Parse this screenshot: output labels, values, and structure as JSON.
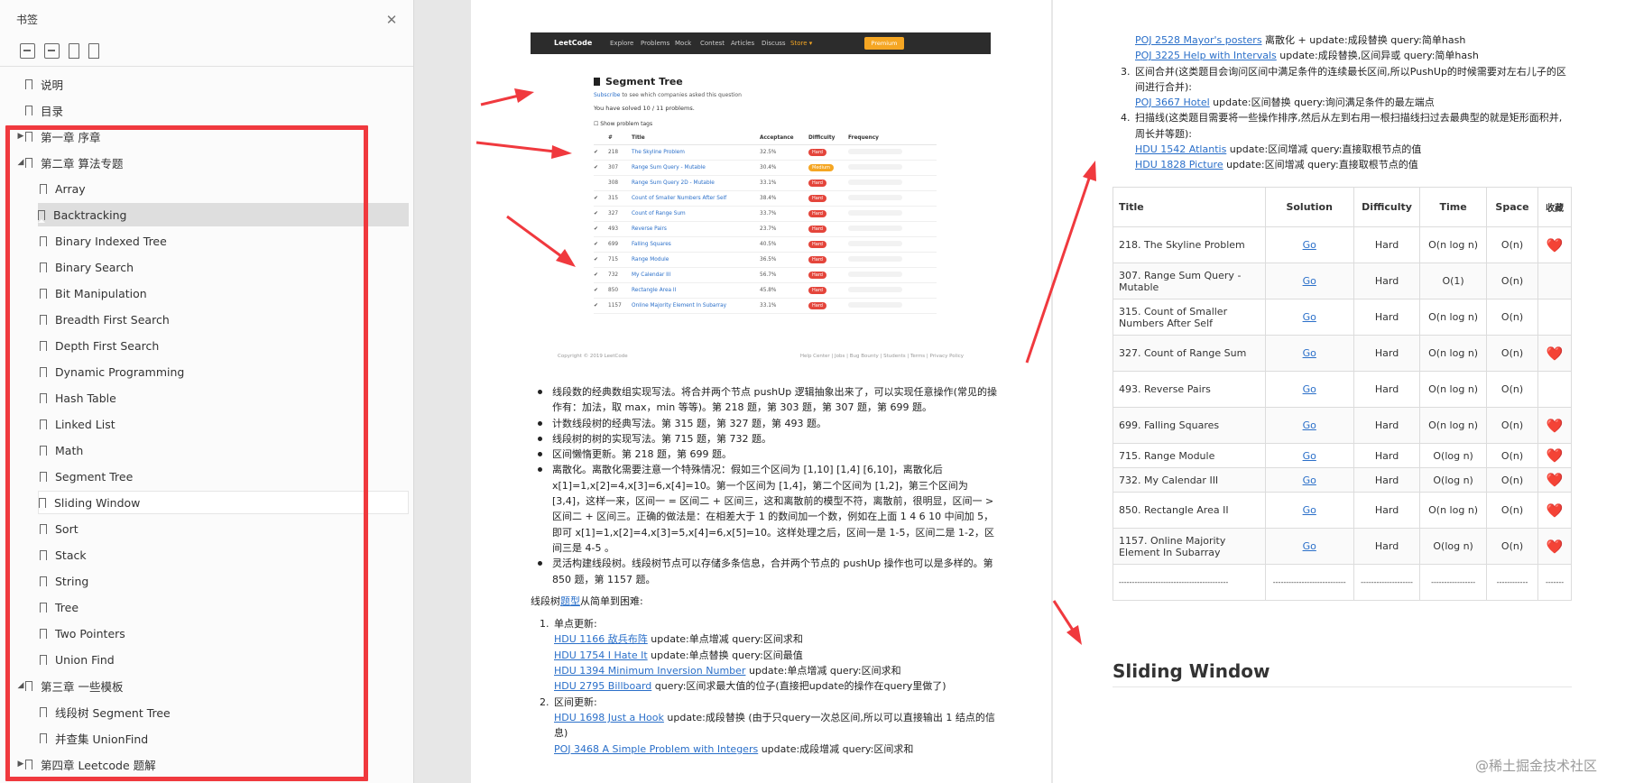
{
  "sidebar": {
    "title": "书签",
    "toc": [
      {
        "label": "说明",
        "level": 0,
        "arrow": ""
      },
      {
        "label": "目录",
        "level": 0,
        "arrow": ""
      },
      {
        "label": "第一章 序章",
        "level": 0,
        "arrow": "▶"
      },
      {
        "label": "第二章 算法专题",
        "level": 0,
        "arrow": "◢"
      },
      {
        "label": "Array",
        "level": 1,
        "arrow": ""
      },
      {
        "label": "Backtracking",
        "level": 1,
        "arrow": "",
        "state": "selected"
      },
      {
        "label": "Binary Indexed Tree",
        "level": 1,
        "arrow": ""
      },
      {
        "label": "Binary Search",
        "level": 1,
        "arrow": ""
      },
      {
        "label": "Bit Manipulation",
        "level": 1,
        "arrow": ""
      },
      {
        "label": "Breadth First Search",
        "level": 1,
        "arrow": ""
      },
      {
        "label": "Depth First Search",
        "level": 1,
        "arrow": ""
      },
      {
        "label": "Dynamic Programming",
        "level": 1,
        "arrow": ""
      },
      {
        "label": "Hash Table",
        "level": 1,
        "arrow": ""
      },
      {
        "label": "Linked List",
        "level": 1,
        "arrow": ""
      },
      {
        "label": "Math",
        "level": 1,
        "arrow": ""
      },
      {
        "label": "Segment Tree",
        "level": 1,
        "arrow": ""
      },
      {
        "label": "Sliding Window",
        "level": 1,
        "arrow": "",
        "state": "hover"
      },
      {
        "label": "Sort",
        "level": 1,
        "arrow": ""
      },
      {
        "label": "Stack",
        "level": 1,
        "arrow": ""
      },
      {
        "label": "String",
        "level": 1,
        "arrow": ""
      },
      {
        "label": "Tree",
        "level": 1,
        "arrow": ""
      },
      {
        "label": "Two Pointers",
        "level": 1,
        "arrow": ""
      },
      {
        "label": "Union Find",
        "level": 1,
        "arrow": ""
      },
      {
        "label": "第三章 一些模板",
        "level": 0,
        "arrow": "◢"
      },
      {
        "label": "线段树 Segment Tree",
        "level": 1,
        "arrow": ""
      },
      {
        "label": "并查集 UnionFind",
        "level": 1,
        "arrow": ""
      },
      {
        "label": "第四章 Leetcode 题解",
        "level": 0,
        "arrow": "▶"
      }
    ]
  },
  "leetcode_shot": {
    "logo": "LeetCode",
    "nav": [
      "Explore",
      "Problems",
      "Mock",
      "Contest",
      "Articles",
      "Discuss",
      "Store ▾"
    ],
    "premium": "Premium",
    "title": "Segment Tree",
    "subscribe_link": "Subscribe",
    "subscribe_rest": " to see which companies asked this question",
    "solved": "You have solved 10 / 11 problems.",
    "show_tags": "Show problem tags",
    "headers": [
      "#",
      "Title",
      "Acceptance",
      "Difficulty",
      "Frequency"
    ],
    "rows": [
      {
        "check": "✔",
        "num": "218",
        "title": "The Skyline Problem",
        "acc": "32.5%",
        "diff": "Hard"
      },
      {
        "check": "✔",
        "num": "307",
        "title": "Range Sum Query - Mutable",
        "acc": "30.4%",
        "diff": "Medium"
      },
      {
        "check": "",
        "num": "308",
        "title": "Range Sum Query 2D - Mutable",
        "acc": "33.1%",
        "diff": "Hard"
      },
      {
        "check": "✔",
        "num": "315",
        "title": "Count of Smaller Numbers After Self",
        "acc": "38.4%",
        "diff": "Hard"
      },
      {
        "check": "✔",
        "num": "327",
        "title": "Count of Range Sum",
        "acc": "33.7%",
        "diff": "Hard"
      },
      {
        "check": "✔",
        "num": "493",
        "title": "Reverse Pairs",
        "acc": "23.7%",
        "diff": "Hard"
      },
      {
        "check": "✔",
        "num": "699",
        "title": "Falling Squares",
        "acc": "40.5%",
        "diff": "Hard"
      },
      {
        "check": "✔",
        "num": "715",
        "title": "Range Module",
        "acc": "36.5%",
        "diff": "Hard"
      },
      {
        "check": "✔",
        "num": "732",
        "title": "My Calendar III",
        "acc": "56.7%",
        "diff": "Hard"
      },
      {
        "check": "✔",
        "num": "850",
        "title": "Rectangle Area II",
        "acc": "45.8%",
        "diff": "Hard"
      },
      {
        "check": "✔",
        "num": "1157",
        "title": "Online Majority Element In Subarray",
        "acc": "33.1%",
        "diff": "Hard"
      }
    ],
    "footer_left": "Copyright © 2019 LeetCode",
    "footer_right": "Help Center | Jobs | Bug Bounty | Students | Terms | Privacy Policy"
  },
  "page1": {
    "bullets": [
      "线段数的经典数组实现写法。将合并两个节点 pushUp 逻辑抽象出来了，可以实现任意操作(常见的操作有：加法，取 max，min 等等)。第 218 题，第 303 题，第 307 题，第 699 题。",
      "计数线段树的经典写法。第 315 题，第 327 题，第 493 题。",
      "线段树的树的实现写法。第 715 题，第 732 题。",
      "区间懒惰更新。第 218 题，第 699 题。",
      "离散化。离散化需要注意一个特殊情况：假如三个区间为 [1,10] [1,4] [6,10]，离散化后 x[1]=1,x[2]=4,x[3]=6,x[4]=10。第一个区间为 [1,4]，第二个区间为 [1,2]，第三个区间为 [3,4]，这样一来，区间一 = 区间二 + 区间三，这和离散前的模型不符，离散前，很明显，区间一 > 区间二 + 区间三。正确的做法是：在相差大于 1 的数间加一个数，例如在上面 1 4 6 10 中间加 5，即可 x[1]=1,x[2]=4,x[3]=5,x[4]=6,x[5]=10。这样处理之后，区间一是 1-5，区间二是 1-2，区间三是 4-5 。",
      "灵活构建线段树。线段树节点可以存储多条信息，合并两个节点的 pushUp 操作也可以是多样的。第 850 题，第 1157 题。"
    ],
    "intro_pre": "线段树",
    "intro_link": "题型",
    "intro_post": "从简单到困难:",
    "list": [
      {
        "num": "1.",
        "title": "单点更新:",
        "items": [
          {
            "link": "HDU 1166 敌兵布阵",
            "text": " update:单点增减 query:区间求和"
          },
          {
            "link": "HDU 1754 I Hate It",
            "text": " update:单点替换 query:区间最值"
          },
          {
            "link": "HDU 1394 Minimum Inversion Number",
            "text": " update:单点增减 query:区间求和"
          },
          {
            "link": "HDU 2795 Billboard",
            "text": " query:区间求最大值的位子(直接把update的操作在query里做了)"
          }
        ]
      },
      {
        "num": "2.",
        "title": "区间更新:",
        "items": [
          {
            "link": "HDU 1698 Just a Hook",
            "text": " update:成段替换 (由于只query一次总区间,所以可以直接输出 1 结点的信息)"
          },
          {
            "link": "POJ 3468 A Simple Problem with Integers",
            "text": " update:成段增减 query:区间求和"
          }
        ]
      }
    ]
  },
  "page2": {
    "top_items": [
      {
        "link": "POJ 2528 Mayor's posters",
        "text": " 离散化 + update:成段替换 query:简单hash"
      },
      {
        "link": "POJ 3225 Help with Intervals",
        "text": " update:成段替换,区间异或 query:简单hash"
      }
    ],
    "item3_num": "3.",
    "item3_text": "区间合并(这类题目会询问区间中满足条件的连续最长区间,所以PushUp的时候需要对左右儿子的区间进行合并):",
    "item3_sub": {
      "link": "POJ 3667 Hotel",
      "text": " update:区间替换 query:询问满足条件的最左端点"
    },
    "item4_num": "4.",
    "item4_text": "扫描线(这类题目需要将一些操作排序,然后从左到右用一根扫描线扫过去最典型的就是矩形面积并,周长并等题):",
    "item4_subs": [
      {
        "link": "HDU 1542 Atlantis",
        "text": " update:区间增减 query:直接取根节点的值"
      },
      {
        "link": "HDU 1828 Picture",
        "text": " update:区间增减 query:直接取根节点的值"
      }
    ],
    "table_headers": [
      "Title",
      "Solution",
      "Difficulty",
      "Time",
      "Space",
      "收藏"
    ],
    "table_rows": [
      {
        "title": "218. The Skyline Problem",
        "solution": "Go",
        "difficulty": "Hard",
        "time": "O(n log n)",
        "space": "O(n)",
        "fav": "❤️"
      },
      {
        "title": "307. Range Sum Query - Mutable",
        "solution": "Go",
        "difficulty": "Hard",
        "time": "O(1)",
        "space": "O(n)",
        "fav": ""
      },
      {
        "title": "315. Count of Smaller Numbers After Self",
        "solution": "Go",
        "difficulty": "Hard",
        "time": "O(n log n)",
        "space": "O(n)",
        "fav": ""
      },
      {
        "title": "327. Count of Range Sum",
        "solution": "Go",
        "difficulty": "Hard",
        "time": "O(n log n)",
        "space": "O(n)",
        "fav": "❤️"
      },
      {
        "title": "493. Reverse Pairs",
        "solution": "Go",
        "difficulty": "Hard",
        "time": "O(n log n)",
        "space": "O(n)",
        "fav": ""
      },
      {
        "title": "699. Falling Squares",
        "solution": "Go",
        "difficulty": "Hard",
        "time": "O(n log n)",
        "space": "O(n)",
        "fav": "❤️"
      },
      {
        "title": "715. Range Module",
        "solution": "Go",
        "difficulty": "Hard",
        "time": "O(log n)",
        "space": "O(n)",
        "fav": "❤️"
      },
      {
        "title": "732. My Calendar III",
        "solution": "Go",
        "difficulty": "Hard",
        "time": "O(log n)",
        "space": "O(n)",
        "fav": "❤️"
      },
      {
        "title": "850. Rectangle Area II",
        "solution": "Go",
        "difficulty": "Hard",
        "time": "O(n log n)",
        "space": "O(n)",
        "fav": "❤️"
      },
      {
        "title": "1157. Online Majority Element In Subarray",
        "solution": "Go",
        "difficulty": "Hard",
        "time": "O(log n)",
        "space": "O(n)",
        "fav": "❤️"
      },
      {
        "title": "------------------------------------------",
        "solution": "----------------------------",
        "difficulty": "--------------------",
        "time": "-----------------",
        "space": "------------",
        "fav": "-------"
      }
    ],
    "heading": "Sliding Window"
  },
  "watermark": "@稀土掘金技术社区",
  "colors": {
    "annotation_red": "#f0393e",
    "link_blue": "#2a6fc9",
    "heart": "#e0352b"
  }
}
